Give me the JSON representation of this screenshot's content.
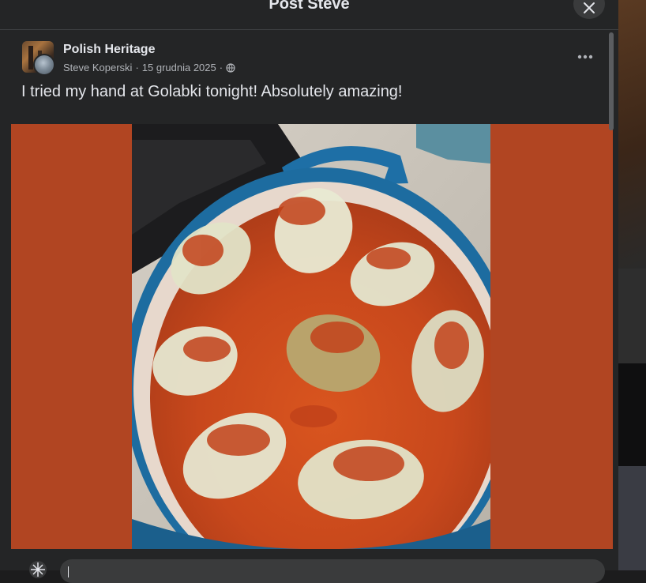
{
  "modal": {
    "title": "Post Steve"
  },
  "post": {
    "group_name": "Polish Heritage",
    "author": "Steve Koperski",
    "separator": "·",
    "date": "15 grudnia 2025",
    "audience_icon": "globe-icon",
    "text": "I tried my hand at Golabki tonight! Absolutely amazing!",
    "more_icon": "more-options-icon"
  },
  "media": {
    "background_color": "#b14522",
    "subject": "photo"
  },
  "comment": {
    "placeholder": ""
  }
}
